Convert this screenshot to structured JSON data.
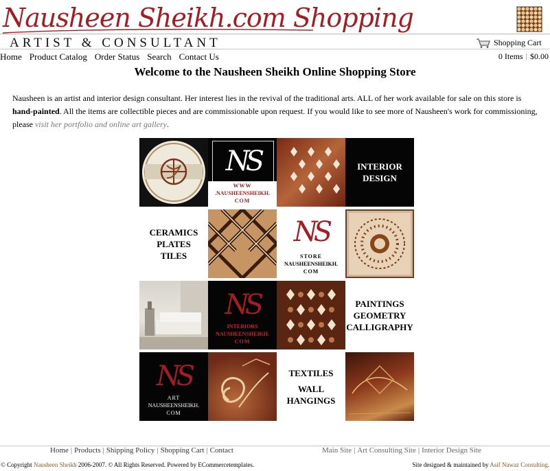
{
  "header": {
    "logo_text": "Nausheen Sheikh.com Shopping",
    "subtitle": "ARTIST & CONSULTANT",
    "cart_link": "Shopping Cart",
    "cart_items": "0 Items",
    "cart_total": "$0.00",
    "cart_separator": "|"
  },
  "nav": {
    "items": [
      "Home",
      "Product Catalog",
      "Order Status",
      "Search",
      "Contact Us"
    ]
  },
  "main": {
    "title": "Welcome to the Nausheen Sheikh Online Shopping Store",
    "intro_1": "Nausheen is an artist and interior design consultant. Her interest lies in the revival of the traditional arts. ALL of her work available for sale on this store is ",
    "intro_bold": "hand-painted",
    "intro_2": ". All the items are collectible pieces and are commissionable upon request. If you would like to see more of Nausheen's work for commissioning, please ",
    "intro_link": "visit her portfolio and online art gallery",
    "intro_end": "."
  },
  "grid": {
    "monogram": "NS",
    "www_caption_1": "WWW",
    "www_caption_2": ".NAUSHEENSHEIKH.",
    "www_caption_3": "COM",
    "interior_design": [
      "INTERIOR",
      "DESIGN"
    ],
    "ceramics": [
      "CERAMICS",
      "PLATES",
      "TILES"
    ],
    "store_caption_1": "STORE",
    "store_caption_2": "NAUSHEENSHEIKH.",
    "store_caption_3": "COM",
    "interiors_caption_1": "INTERIORS",
    "interiors_caption_2": "NAUSHEENSHEIKH.",
    "interiors_caption_3": "COM",
    "paintings": [
      "PAINTINGS",
      "GEOMETRY",
      "CALLIGRAPHY"
    ],
    "art_caption_1": "ART",
    "art_caption_2": "NAUSHEENSHEIKH.",
    "art_caption_3": "COM",
    "textiles": [
      "TEXTILES",
      "WALL",
      "HANGINGS"
    ]
  },
  "footer": {
    "left_links": [
      "Home",
      "Products",
      "Shipping Policy",
      "Shopping Cart",
      "Contact"
    ],
    "right_links": [
      "Main Site",
      "Art Consulting Site",
      "Interior Design Site"
    ],
    "separator": "|",
    "copyright_prefix": "© Copyright ",
    "copyright_name": "Nausheen Sheikh",
    "copyright_suffix": " 2006-2007. © All Rights Reserved. Powered by ",
    "copyright_powered": "ECommercetemplates",
    "copyright_end": ".",
    "maintained_prefix": "Site designed & maintained by ",
    "maintained_name": "Asif Nawaz Consulting",
    "maintained_end": "."
  },
  "colors": {
    "brand_red": "#a31e24",
    "muted_link": "#777777",
    "accent_brown": "#8b5a2b"
  },
  "icons": [
    "shopping-cart-icon"
  ]
}
